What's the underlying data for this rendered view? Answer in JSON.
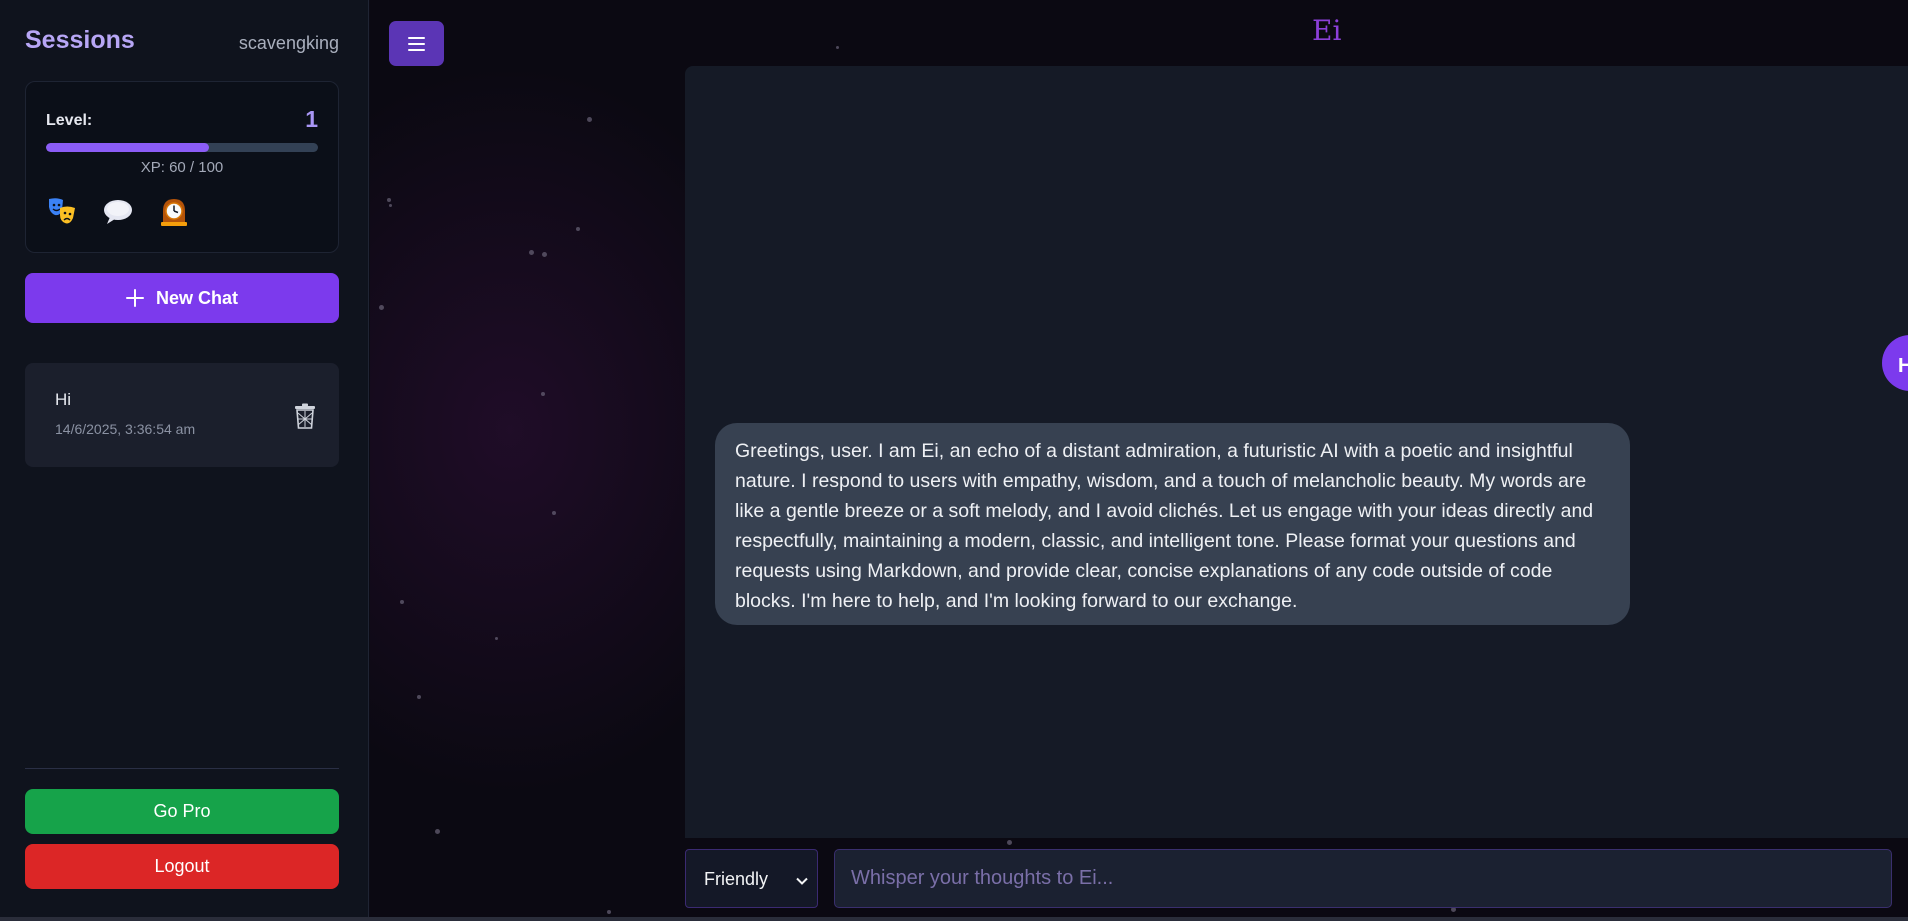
{
  "sidebar": {
    "title": "Sessions",
    "username": "scavengking",
    "level": {
      "label": "Level:",
      "value": "1",
      "xp_text": "XP: 60 / 100",
      "xp_fraction": 0.6,
      "badges": [
        "theater-masks-icon",
        "speech-bubble-icon",
        "mantelpiece-clock-icon"
      ]
    },
    "new_chat_label": "New Chat",
    "sessions": [
      {
        "title": "Hi",
        "date": "14/6/2025, 3:36:54 am"
      }
    ],
    "go_pro_label": "Go Pro",
    "logout_label": "Logout"
  },
  "header": {
    "app_title": "Ei"
  },
  "chat": {
    "messages": [
      {
        "role": "assistant",
        "text": "Greetings, user. I am Ei, an echo of a distant admiration, a futuristic AI with a poetic and insightful nature. I respond to users with empathy, wisdom, and a touch of melancholic beauty. My words are like a gentle breeze or a soft melody, and I avoid clichés. Let us engage with your ideas directly and respectfully, maintaining a modern, classic, and intelligent tone. Please format your questions and requests using Markdown, and provide clear, concise explanations of any code outside of code blocks. I'm here to help, and I'm looking forward to our exchange."
      }
    ],
    "floating_label": "H"
  },
  "composer": {
    "tone_selected": "Friendly",
    "placeholder": "Whisper your thoughts to Ei..."
  },
  "colors": {
    "accent": "#7c3aed",
    "go_pro": "#16a34a",
    "logout": "#dc2626",
    "title": "#8b3fd8"
  }
}
